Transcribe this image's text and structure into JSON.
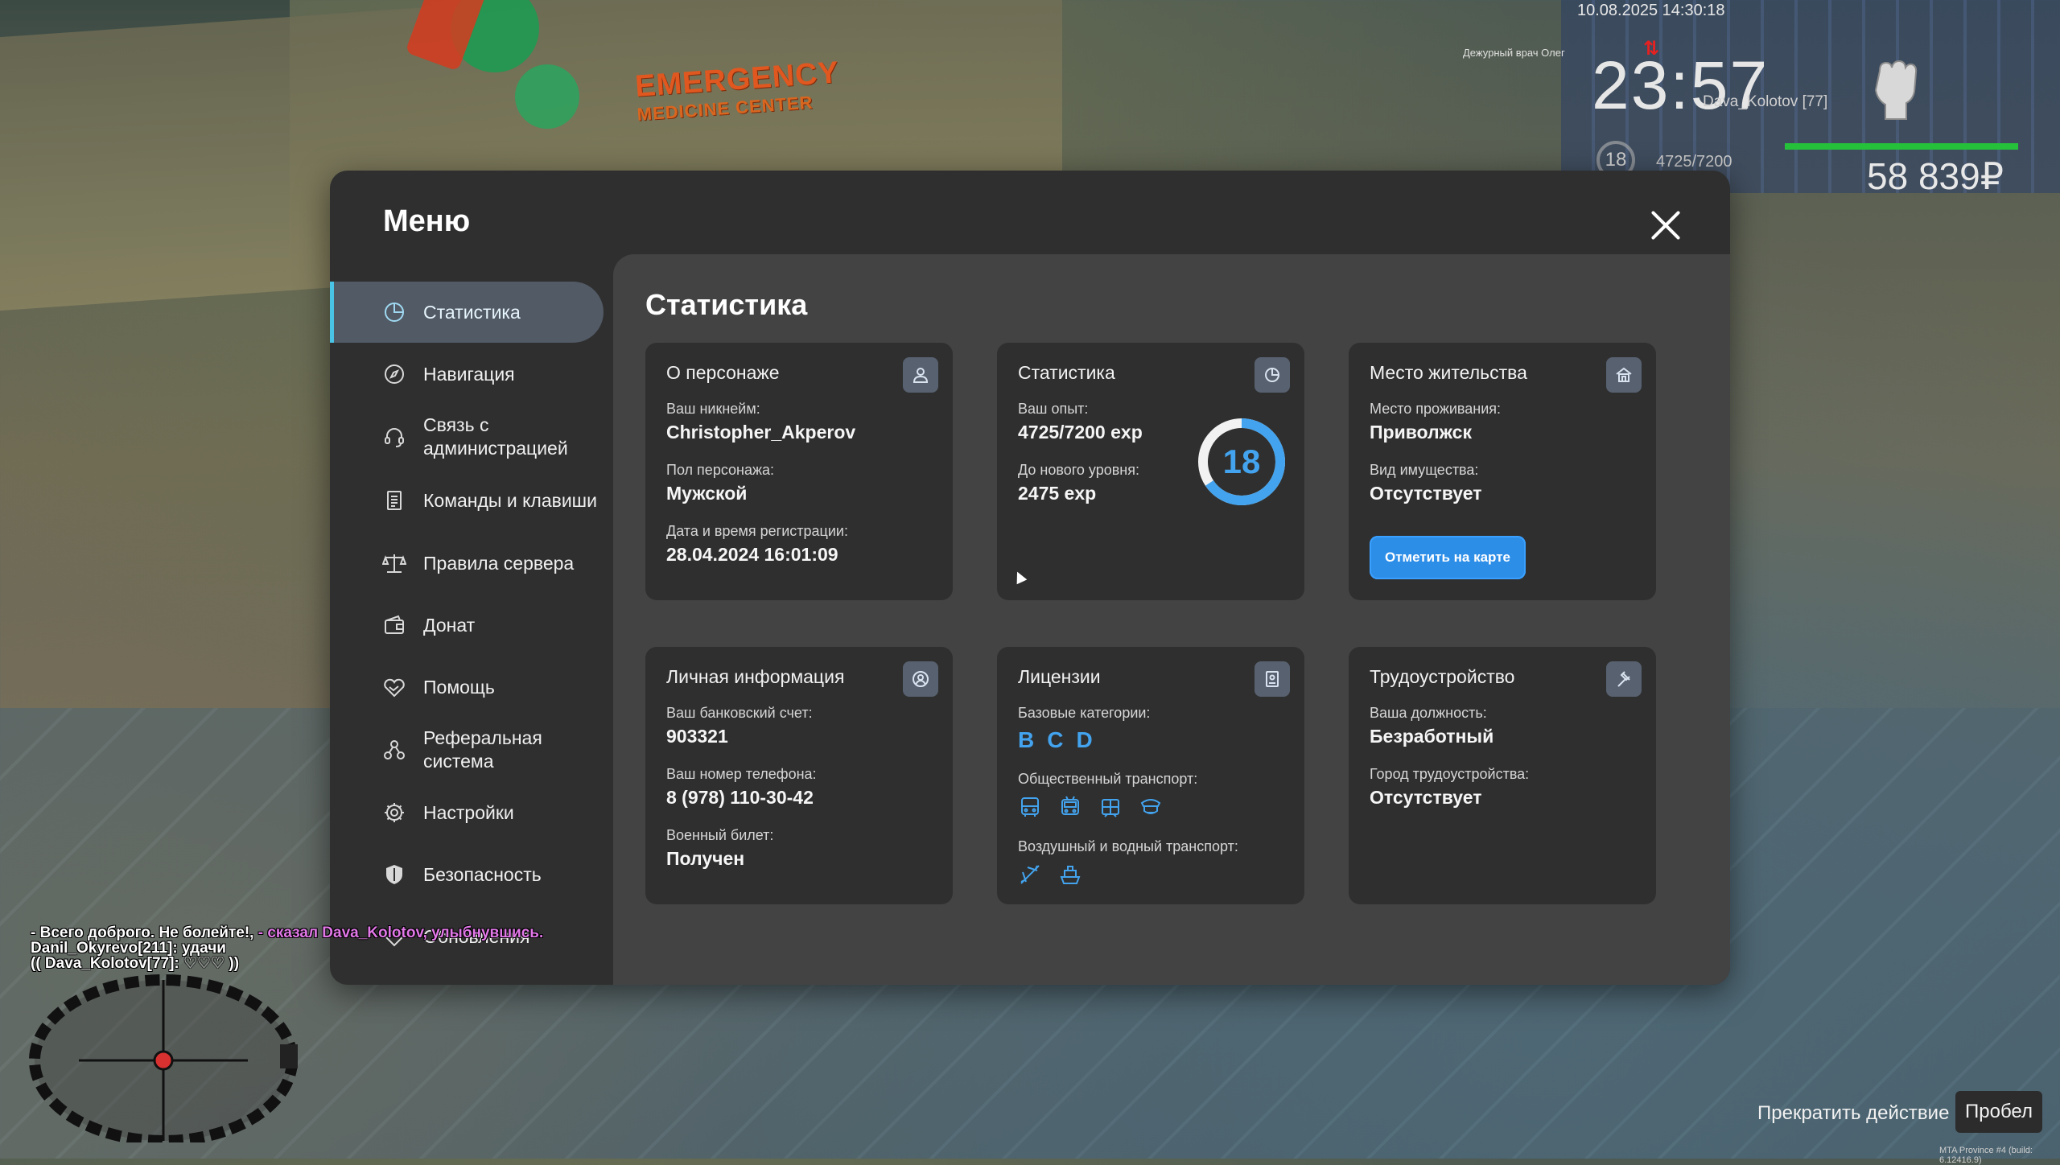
{
  "hud": {
    "date_time": "10.08.2025 14:30:18",
    "clock": "23:57",
    "player_tag": "Dava_Kolotov [77]",
    "npc_label": "Дежурный врач Олег",
    "level": "18",
    "exp": "4725/7200",
    "health_percent": 100,
    "money": "58 839₽",
    "sign_top": "EMERGENCY",
    "sign_bottom": "MEDICINE CENTER"
  },
  "menu": {
    "title": "Меню",
    "nav": [
      {
        "label": "Статистика",
        "icon": "pie-chart-icon"
      },
      {
        "label": "Навигация",
        "icon": "compass-icon"
      },
      {
        "label": "Связь с администрацией",
        "icon": "headset-icon"
      },
      {
        "label": "Команды и клавиши",
        "icon": "document-icon"
      },
      {
        "label": "Правила сервера",
        "icon": "scales-icon"
      },
      {
        "label": "Донат",
        "icon": "wallet-icon"
      },
      {
        "label": "Помощь",
        "icon": "handshake-heart-icon"
      },
      {
        "label": "Реферальная система",
        "icon": "people-network-icon"
      },
      {
        "label": "Настройки",
        "icon": "gear-icon"
      },
      {
        "label": "Безопасность",
        "icon": "shield-icon"
      },
      {
        "label": "Обновления",
        "icon": "update-icon"
      }
    ],
    "active_index": 0
  },
  "content": {
    "title": "Статистика",
    "character": {
      "title": "О персонаже",
      "nickname_label": "Ваш никнейм:",
      "nickname": "Christopher_Akperov",
      "gender_label": "Пол персонажа:",
      "gender": "Мужской",
      "reg_label": "Дата и время регистрации:",
      "reg_date": "28.04.2024 16:01:09"
    },
    "stats": {
      "title": "Статистика",
      "exp_label": "Ваш опыт:",
      "exp": "4725/7200 exp",
      "next_label": "До нового уровня:",
      "next": "2475 exp",
      "level": "18",
      "progress": 0.656
    },
    "residence": {
      "title": "Место жительства",
      "place_label": "Место проживания:",
      "place": "Приволжск",
      "property_label": "Вид имущества:",
      "property": "Отсутствует",
      "button": "Отметить на карте"
    },
    "personal": {
      "title": "Личная информация",
      "bank_label": "Ваш банковский счет:",
      "bank": "903321",
      "phone_label": "Ваш номер телефона:",
      "phone": "8 (978) 110-30-42",
      "military_label": "Военный билет:",
      "military": "Получен"
    },
    "licenses": {
      "title": "Лицензии",
      "base_label": "Базовые категории:",
      "categories": [
        "B",
        "C",
        "D"
      ],
      "public_label": "Общественный транспорт:",
      "air_label": "Воздушный и водный транспорт:"
    },
    "employment": {
      "title": "Трудоустройство",
      "position_label": "Ваша должность:",
      "position": "Безработный",
      "city_label": "Город трудоустройства:",
      "city": "Отсутствует"
    }
  },
  "chat": {
    "line1_a": "- Всего доброго. Не болейте!,",
    "line1_b": " - сказал Dava_Kolotov, улыбнувшись.",
    "line2": "Danil_Okyrevo[211]: удачи",
    "line3": "(( Dava_Kolotov[77]: ♡♡♡ ))"
  },
  "footer": {
    "action": "Прекратить действие",
    "key": "Пробел",
    "build": "MTA Province #4 (build: 6.12416.9)"
  },
  "colors": {
    "accent_blue": "#43a3ee",
    "active_bar": "#49c3e6",
    "button_blue": "#2d8ee8",
    "health_green": "#26c13b"
  }
}
